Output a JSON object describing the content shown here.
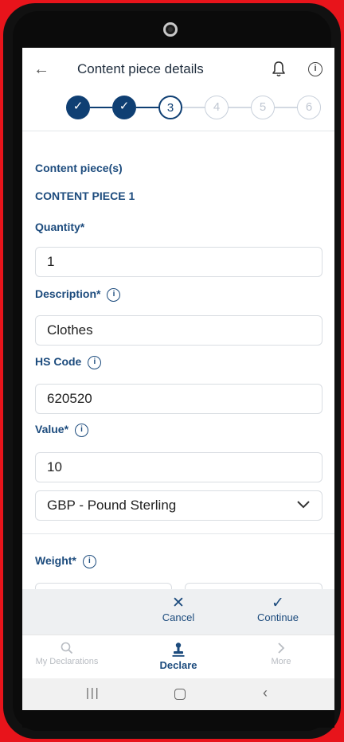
{
  "header": {
    "back_icon": "arrow-left-icon",
    "title": "Content piece details",
    "bell_icon": "bell-icon",
    "info_icon": "info-icon"
  },
  "stepper": {
    "steps": [
      {
        "label": "✓",
        "state": "done"
      },
      {
        "label": "✓",
        "state": "done"
      },
      {
        "label": "3",
        "state": "current"
      },
      {
        "label": "4",
        "state": "todo"
      },
      {
        "label": "5",
        "state": "todo"
      },
      {
        "label": "6",
        "state": "todo"
      }
    ]
  },
  "form": {
    "section_title": "Content piece(s)",
    "piece_title": "CONTENT PIECE 1",
    "quantity_label": "Quantity*",
    "quantity_value": "1",
    "description_label": "Description*",
    "description_value": "Clothes",
    "hs_code_label": "HS Code",
    "hs_code_value": "620520",
    "value_label": "Value*",
    "value_value": "10",
    "currency_value": "GBP - Pound Sterling",
    "weight_label": "Weight*"
  },
  "actions": {
    "cancel_icon": "x-icon",
    "cancel_label": "Cancel",
    "continue_icon": "check-icon",
    "continue_label": "Continue"
  },
  "bottom_nav": {
    "items": [
      {
        "label": "My Declarations",
        "icon": "search-icon"
      },
      {
        "label": "Declare",
        "icon": "stamp-icon"
      },
      {
        "label": "More",
        "icon": "chevron-right-icon"
      }
    ]
  },
  "system_nav": {
    "recents_icon": "recents-icon",
    "home_icon": "home-icon",
    "back_icon": "back-icon"
  },
  "colors": {
    "primary": "#0f3f73",
    "label": "#1c4b7d",
    "frame": "#e8141b"
  }
}
